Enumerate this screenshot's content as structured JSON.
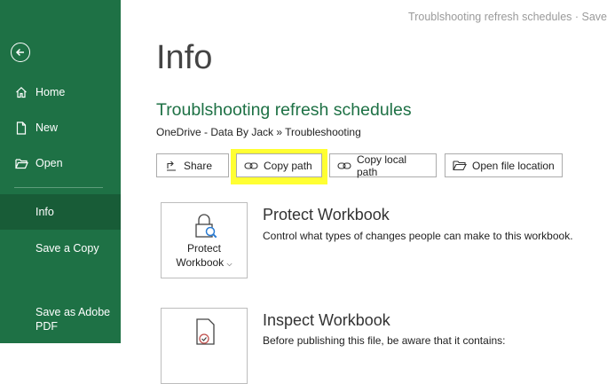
{
  "titlebar": {
    "text": "Troublshooting refresh schedules  ·  Save"
  },
  "sidebar": {
    "items": [
      {
        "label": "Home",
        "icon": "home-icon"
      },
      {
        "label": "New",
        "icon": "new-file-icon"
      },
      {
        "label": "Open",
        "icon": "folder-open-icon"
      },
      {
        "label": "Info"
      },
      {
        "label": "Save a Copy"
      },
      {
        "label": "Save as Adobe PDF"
      }
    ],
    "active": "Info"
  },
  "main": {
    "page_title": "Info",
    "doc_title": "Troublshooting refresh schedules",
    "doc_path": "OneDrive - Data By Jack » Troubleshooting",
    "buttons": {
      "share": "Share",
      "copy_path": "Copy path",
      "copy_local_path": "Copy local path",
      "open_file_location": "Open file location"
    },
    "protect": {
      "card_label_1": "Protect",
      "card_label_2": "Workbook",
      "title": "Protect Workbook",
      "desc": "Control what types of changes people can make to this workbook."
    },
    "inspect": {
      "title": "Inspect Workbook",
      "desc": "Before publishing this file, be aware that it contains:"
    }
  },
  "colors": {
    "sidebar_bg": "#1e7145",
    "sidebar_active": "#185c37",
    "accent_green": "#1e7145",
    "highlight_yellow": "#ffff33"
  }
}
